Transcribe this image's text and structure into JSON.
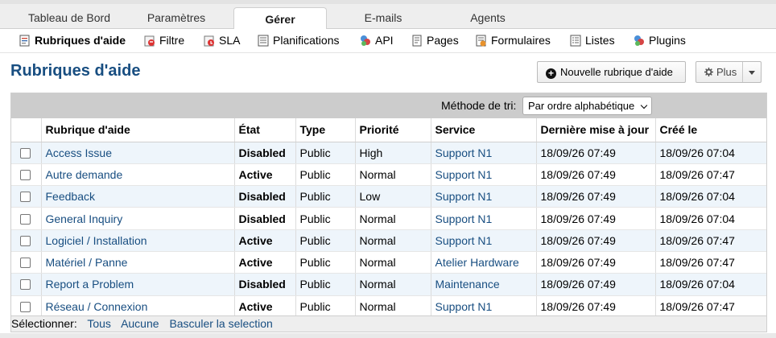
{
  "tabs": [
    {
      "label": "Tableau de Bord",
      "active": false
    },
    {
      "label": "Paramètres",
      "active": false
    },
    {
      "label": "Gérer",
      "active": true
    },
    {
      "label": "E-mails",
      "active": false
    },
    {
      "label": "Agents",
      "active": false
    }
  ],
  "subnav": [
    {
      "label": "Rubriques d'aide",
      "icon": "help-topics-icon",
      "active": true
    },
    {
      "label": "Filtre",
      "icon": "filter-icon",
      "active": false
    },
    {
      "label": "SLA",
      "icon": "sla-icon",
      "active": false
    },
    {
      "label": "Planifications",
      "icon": "schedule-icon",
      "active": false
    },
    {
      "label": "API",
      "icon": "api-icon",
      "active": false
    },
    {
      "label": "Pages",
      "icon": "pages-icon",
      "active": false
    },
    {
      "label": "Formulaires",
      "icon": "forms-icon",
      "active": false
    },
    {
      "label": "Listes",
      "icon": "lists-icon",
      "active": false
    },
    {
      "label": "Plugins",
      "icon": "plugins-icon",
      "active": false
    }
  ],
  "page": {
    "title": "Rubriques d'aide",
    "new_button": "Nouvelle rubrique d'aide",
    "more_button": "Plus"
  },
  "sort": {
    "label": "Méthode de tri:",
    "selected": "Par ordre alphabétique"
  },
  "table": {
    "columns": [
      "Rubrique d'aide",
      "État",
      "Type",
      "Priorité",
      "Service",
      "Dernière mise à jour",
      "Créé le"
    ],
    "rows": [
      {
        "topic": "Access Issue",
        "state": "Disabled",
        "type": "Public",
        "priority": "High",
        "service": "Support N1",
        "updated": "18/09/26 07:49",
        "created": "18/09/26 07:04"
      },
      {
        "topic": "Autre demande",
        "state": "Active",
        "type": "Public",
        "priority": "Normal",
        "service": "Support N1",
        "updated": "18/09/26 07:49",
        "created": "18/09/26 07:47"
      },
      {
        "topic": "Feedback",
        "state": "Disabled",
        "type": "Public",
        "priority": "Low",
        "service": "Support N1",
        "updated": "18/09/26 07:49",
        "created": "18/09/26 07:04"
      },
      {
        "topic": "General Inquiry",
        "state": "Disabled",
        "type": "Public",
        "priority": "Normal",
        "service": "Support N1",
        "updated": "18/09/26 07:49",
        "created": "18/09/26 07:04"
      },
      {
        "topic": "Logiciel / Installation",
        "state": "Active",
        "type": "Public",
        "priority": "Normal",
        "service": "Support N1",
        "updated": "18/09/26 07:49",
        "created": "18/09/26 07:47"
      },
      {
        "topic": "Matériel / Panne",
        "state": "Active",
        "type": "Public",
        "priority": "Normal",
        "service": "Atelier Hardware",
        "updated": "18/09/26 07:49",
        "created": "18/09/26 07:47"
      },
      {
        "topic": "Report a Problem",
        "state": "Disabled",
        "type": "Public",
        "priority": "Normal",
        "service": "Maintenance",
        "updated": "18/09/26 07:49",
        "created": "18/09/26 07:04"
      },
      {
        "topic": "Réseau / Connexion",
        "state": "Active",
        "type": "Public",
        "priority": "Normal",
        "service": "Support N1",
        "updated": "18/09/26 07:49",
        "created": "18/09/26 07:47"
      }
    ]
  },
  "footer": {
    "label": "Sélectionner:",
    "all": "Tous",
    "none": "Aucune",
    "toggle": "Basculer la selection"
  },
  "colors": {
    "title": "#184e81",
    "link": "#184e81",
    "row_alt": "#eef5fb",
    "sort_bar": "#cccccc"
  }
}
